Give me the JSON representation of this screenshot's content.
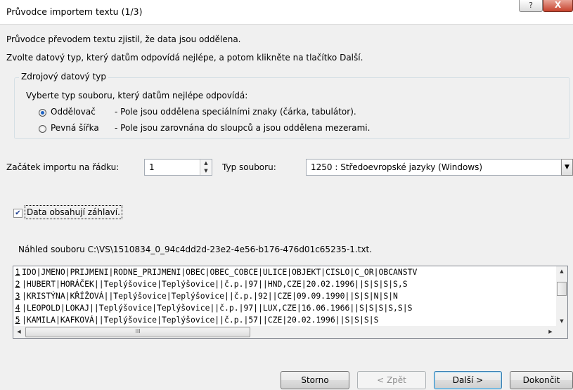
{
  "window": {
    "title": "Průvodce importem textu (1/3)",
    "help_label": "?",
    "close_label": "X"
  },
  "intro": {
    "line1": "Průvodce převodem textu zjistil, že data jsou oddělena.",
    "line2": "Zvolte datový typ, který datům odpovídá nejlépe, a potom klikněte na tlačítko Další."
  },
  "source_group": {
    "legend": "Zdrojový datový typ",
    "prompt": "Vyberte typ souboru, který datům nejlépe odpovídá:",
    "options": [
      {
        "label": "Oddělovač",
        "description": "- Pole jsou oddělena speciálními znaky (čárka, tabulátor).",
        "selected": true
      },
      {
        "label": "Pevná šířka",
        "description": "- Pole jsou zarovnána do sloupců a jsou oddělena mezerami.",
        "selected": false
      }
    ]
  },
  "import_start": {
    "label": "Začátek importu na řádku:",
    "value": "1"
  },
  "file_type": {
    "label": "Typ souboru:",
    "value": "1250 : Středoevropské jazyky (Windows)"
  },
  "headers_checkbox": {
    "label": "Data obsahují záhlaví.",
    "checked": true
  },
  "preview": {
    "label": "Náhled souboru C:\\VS\\1510834_0_94c4dd2d-23e2-4e56-b176-476d01c65235-1.txt.",
    "lines": [
      {
        "num": "1",
        "text": "IDO|JMENO|PRIJMENI|RODNE_PRIJMENI|OBEC|OBEC_COBCE|ULICE|OBJEKT|CISLO|C_OR|OBCANSTV"
      },
      {
        "num": "2",
        "text": "|HUBERT|HORÁČEK||Teplýšovice|Teplýšovice||č.p.|97||HND,CZE|20.02.1996||S|S|S|S,S"
      },
      {
        "num": "3",
        "text": "|KRISTÝNA|KŘÍŽOVÁ||Teplýšovice|Teplýšovice||č.p.|92||CZE|09.09.1990||S|S|N|S|N"
      },
      {
        "num": "4",
        "text": "|LEOPOLD|LOKAJ||Teplýšovice|Teplýšovice||č.p.|97||LUX,CZE|16.06.1966||S|S|S|S,S|S"
      },
      {
        "num": "5",
        "text": "|KAMILA|KAFKOVÁ||Teplýšovice|Teplýšovice||č.p.|57||CZE|20.02.1996||S|S|S|S"
      }
    ],
    "hscroll_grip": "III"
  },
  "buttons": {
    "cancel": "Storno",
    "back": "< Zpět",
    "next": "Další >",
    "finish": "Dokončit"
  }
}
